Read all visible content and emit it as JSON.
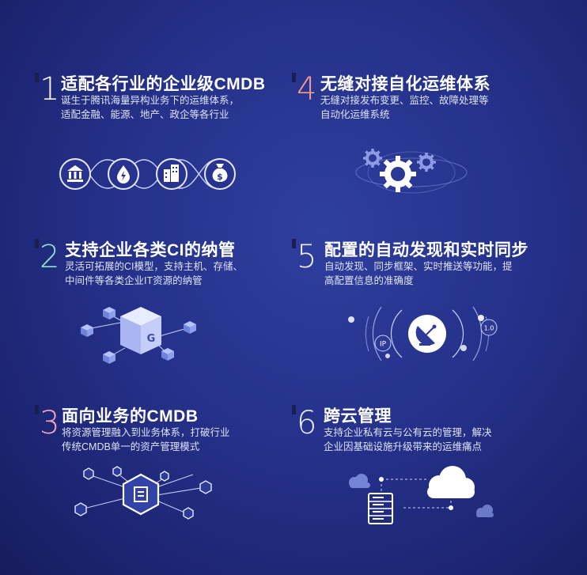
{
  "features": [
    {
      "number": "1",
      "title": "适配各行业的企业级CMDB",
      "desc": [
        "诞生于腾讯海量异构业务下的运维体系，",
        "适配金融、能源、地产、政企等各行业"
      ]
    },
    {
      "number": "2",
      "title": "支持企业各类CI的纳管",
      "desc": [
        "灵活可拓展的CI模型，支持主机、存储、",
        "中间件等各类企业IT资源的纳管"
      ]
    },
    {
      "number": "3",
      "title": "面向业务的CMDB",
      "desc": [
        "将资源管理融入到业务体系，打破行业",
        "传统CMDB单一的资产管理模式"
      ]
    },
    {
      "number": "4",
      "title": "无缝对接自化运维体系",
      "desc": [
        "无缝对接发布变更、监控、故障处理等",
        "自动化运维系统"
      ]
    },
    {
      "number": "5",
      "title": "配置的自动发现和实时同步",
      "desc": [
        "自动发现、同步框架、实时推送等功能，提",
        "高配置信息的准确度"
      ]
    },
    {
      "number": "6",
      "title": "跨云管理",
      "desc": [
        "支持企业私有云与公有云的管理，解决",
        "企业因基础设施升级带来的运维痛点"
      ]
    }
  ],
  "ill5_labels": {
    "ip": "IP",
    "version": "1.0"
  },
  "colors": {
    "bg": "#25318a",
    "accent_gear": "#7f8ee0",
    "node": "#6f83d8"
  }
}
